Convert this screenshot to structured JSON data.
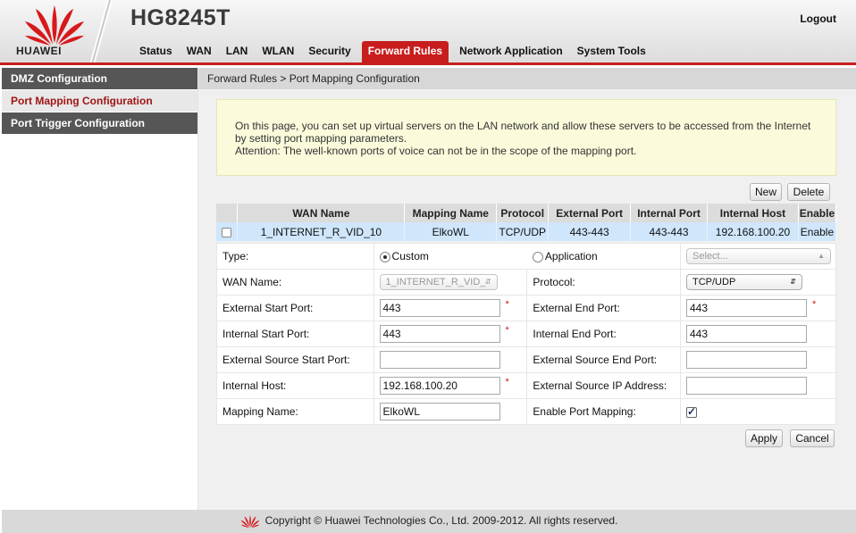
{
  "header": {
    "brand": "HUAWEI",
    "model": "HG8245T",
    "logout_label": "Logout"
  },
  "nav": {
    "items": [
      "Status",
      "WAN",
      "LAN",
      "WLAN",
      "Security",
      "Forward Rules",
      "Network Application",
      "System Tools"
    ],
    "active": "Forward Rules"
  },
  "sidebar": {
    "items": [
      "DMZ Configuration",
      "Port Mapping Configuration",
      "Port Trigger Configuration"
    ],
    "active": "Port Mapping Configuration"
  },
  "breadcrumb": "Forward Rules > Port Mapping Configuration",
  "info": {
    "line1": "On this page, you can set up virtual servers on the LAN network and allow these servers to be accessed from the Internet",
    "line2": "by setting port mapping parameters.",
    "line3": "Attention: The well-known ports of voice can not be in the scope of the mapping port."
  },
  "buttons": {
    "new": "New",
    "delete": "Delete",
    "apply": "Apply",
    "cancel": "Cancel"
  },
  "table": {
    "headers": [
      "WAN Name",
      "Mapping Name",
      "Protocol",
      "External Port",
      "Internal Port",
      "Internal Host",
      "Enable"
    ],
    "row": {
      "wan_name": "1_INTERNET_R_VID_10",
      "mapping_name": "ElkoWL",
      "protocol": "TCP/UDP",
      "external_port": "443-443",
      "internal_port": "443-443",
      "internal_host": "192.168.100.20",
      "enable": "Enable"
    }
  },
  "form": {
    "type_label": "Type:",
    "type_custom": "Custom",
    "type_application": "Application",
    "application_select": "Select...",
    "wan_name_label": "WAN Name:",
    "wan_name_value": "1_INTERNET_R_VID_",
    "protocol_label": "Protocol:",
    "protocol_value": "TCP/UDP",
    "ext_start_label": "External Start Port:",
    "ext_start_value": "443",
    "ext_end_label": "External End Port:",
    "ext_end_value": "443",
    "int_start_label": "Internal Start Port:",
    "int_start_value": "443",
    "int_end_label": "Internal End Port:",
    "int_end_value": "443",
    "src_start_label": "External Source Start Port:",
    "src_start_value": "",
    "src_end_label": "External Source End Port:",
    "src_end_value": "",
    "host_label": "Internal Host:",
    "host_value": "192.168.100.20",
    "src_ip_label": "External Source IP Address:",
    "src_ip_value": "",
    "mapping_name_label": "Mapping Name:",
    "mapping_name_value": "ElkoWL",
    "enable_label": "Enable Port Mapping:",
    "required_mark": "*"
  },
  "footer": {
    "copyright": "Copyright © Huawei Technologies Co., Ltd. 2009-2012. All rights reserved."
  },
  "colors": {
    "accent_red": "#c81d1d",
    "selected_row": "#cfe6fb",
    "info_bg": "#fbfbdc"
  }
}
